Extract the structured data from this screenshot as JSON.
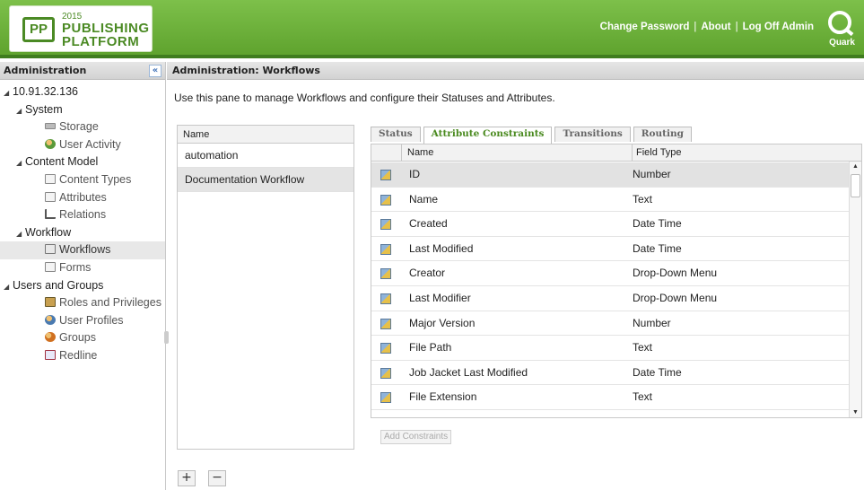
{
  "header": {
    "logo_badge": "PP",
    "logo_year": "2015",
    "logo_line1": "PUBLISHING",
    "logo_line2": "PLATFORM",
    "links": [
      "Change Password",
      "About",
      "Log Off Admin"
    ],
    "quark_label": "Quark",
    "quark_icon": "quark-logo-icon"
  },
  "sidebar": {
    "title": "Administration",
    "collapse": "«",
    "tree": {
      "server": "10.91.32.136",
      "system": "System",
      "storage": "Storage",
      "user_activity": "User Activity",
      "content_model": "Content Model",
      "content_types": "Content Types",
      "attributes": "Attributes",
      "relations": "Relations",
      "workflow": "Workflow",
      "workflows": "Workflows",
      "forms": "Forms",
      "users_and_groups": "Users and Groups",
      "roles": "Roles and Privileges",
      "user_profiles": "User Profiles",
      "groups": "Groups",
      "redline": "Redline"
    },
    "selected": "Workflows"
  },
  "main": {
    "title": "Administration: Workflows",
    "description": "Use this pane to manage Workflows and configure their Statuses and Attributes.",
    "workflows": {
      "column": "Name",
      "rows": [
        "automation",
        "Documentation Workflow"
      ],
      "selected": "Documentation Workflow"
    },
    "add_button": "+",
    "remove_button": "−",
    "tabs": [
      "Status",
      "Attribute Constraints",
      "Transitions",
      "Routing"
    ],
    "active_tab": "Attribute Constraints",
    "grid": {
      "col_name": "Name",
      "col_type": "Field Type",
      "rows": [
        {
          "name": "ID",
          "type": "Number"
        },
        {
          "name": "Name",
          "type": "Text"
        },
        {
          "name": "Created",
          "type": "Date Time"
        },
        {
          "name": "Last Modified",
          "type": "Date Time"
        },
        {
          "name": "Creator",
          "type": "Drop-Down Menu"
        },
        {
          "name": "Last Modifier",
          "type": "Drop-Down Menu"
        },
        {
          "name": "Major Version",
          "type": "Number"
        },
        {
          "name": "File Path",
          "type": "Text"
        },
        {
          "name": "Job Jacket Last Modified",
          "type": "Date Time"
        },
        {
          "name": "File Extension",
          "type": "Text"
        }
      ],
      "selected_row": "ID"
    },
    "add_constraints": "Add Constraints"
  }
}
